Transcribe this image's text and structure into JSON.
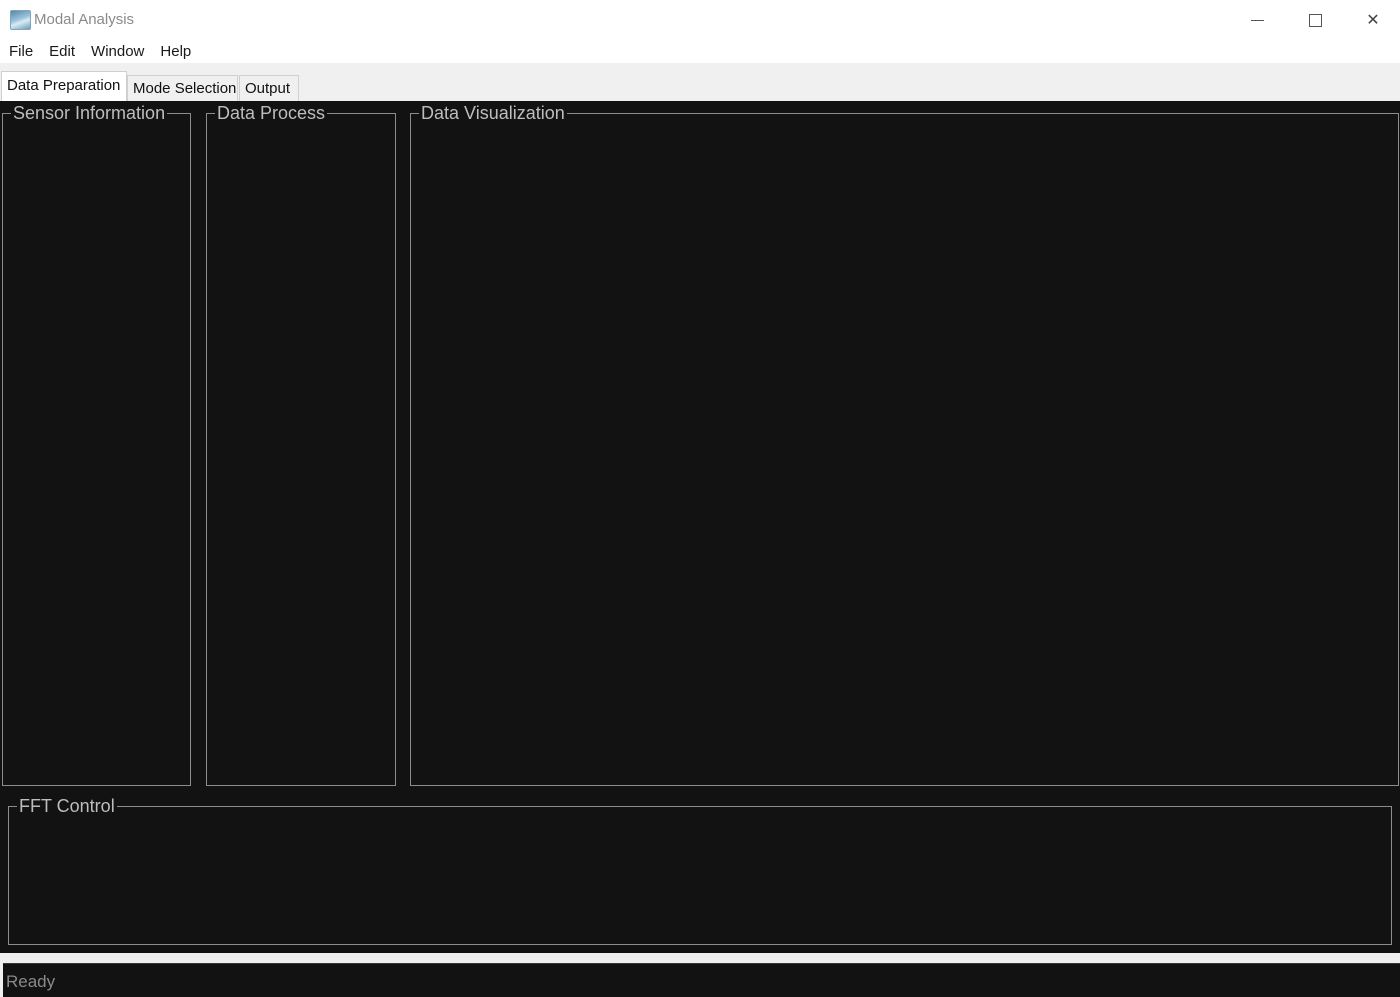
{
  "window": {
    "title": "Modal Analysis",
    "icon": "app-icon",
    "controls": {
      "minimize": "minimize-icon",
      "maximize": "maximize-icon",
      "close": "close-icon"
    }
  },
  "menu": {
    "items": [
      {
        "label": "File"
      },
      {
        "label": "Edit"
      },
      {
        "label": "Window"
      },
      {
        "label": "Help"
      }
    ]
  },
  "tabs": {
    "items": [
      {
        "label": "Data Preparation",
        "active": true
      },
      {
        "label": "Mode Selection",
        "active": false
      },
      {
        "label": "Output",
        "active": false
      }
    ]
  },
  "panels": {
    "sensor_information": "Sensor Information",
    "data_process": "Data Process",
    "data_visualization": "Data Visualization",
    "fft_control": "FFT Control"
  },
  "status": {
    "text": "Ready"
  },
  "colors": {
    "content_background": "#121212",
    "groupbox_border": "#8c8c8c",
    "legend_text": "#bdbdbd",
    "status_text": "#8a8a8a"
  }
}
